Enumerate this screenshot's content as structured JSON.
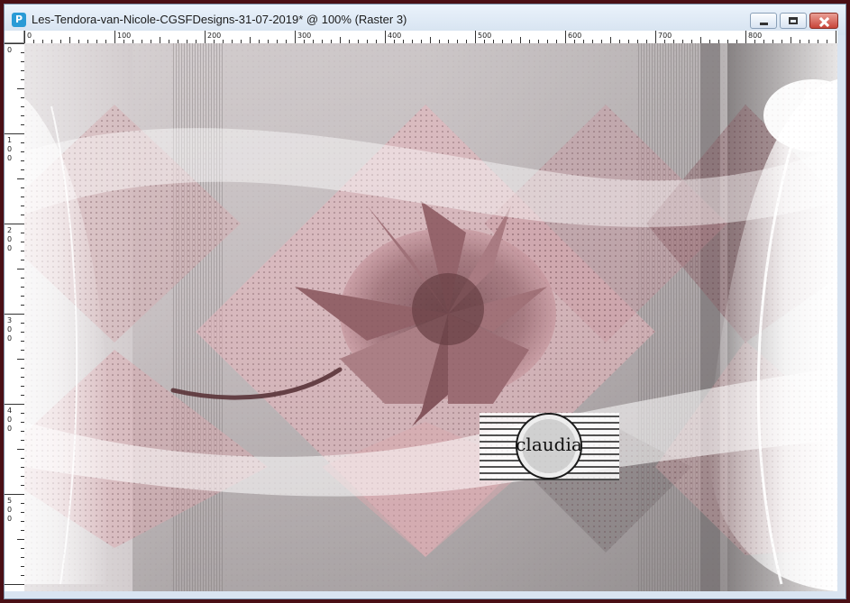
{
  "window": {
    "title": "Les-Tendora-van-Nicole-CGSFDesigns-31-07-2019* @ 100% (Raster 3)",
    "app_icon": "psp-app-icon",
    "buttons": [
      "minimize",
      "maximize",
      "close"
    ]
  },
  "ruler": {
    "horizontal_labels": [
      "0",
      "100",
      "200",
      "300",
      "400",
      "500",
      "600",
      "700",
      "800"
    ],
    "vertical_labels": [
      "0",
      "100",
      "200",
      "300",
      "400",
      "500"
    ]
  },
  "canvas": {
    "zoom": "100%",
    "layer": "Raster 3",
    "watermark_text": "claudia",
    "colors": {
      "rose": "#c9949c",
      "dark_rose": "#7a4a52",
      "grey": "#8c8a8b",
      "white": "#f6f6f6"
    }
  }
}
